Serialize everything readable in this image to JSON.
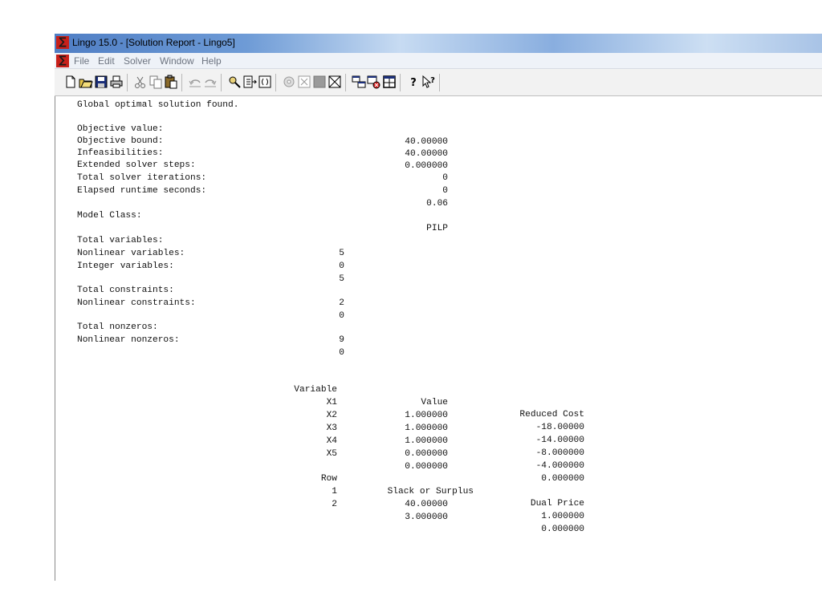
{
  "window": {
    "title": "Lingo 15.0 - [Solution Report - Lingo5]"
  },
  "menu": [
    "File",
    "Edit",
    "Solver",
    "Window",
    "Help"
  ],
  "toolbar": {
    "buttons": [
      "new-icon",
      "open-icon",
      "save-icon",
      "print-icon",
      "cut-icon",
      "copy-icon",
      "paste-icon",
      "undo-icon",
      "redo-icon",
      "find-icon",
      "goto-line-icon",
      "match-paren-icon",
      "solve-icon",
      "solution-icon",
      "stop-icon",
      "close-all-icon",
      "tile-icon",
      "send-to-back-icon",
      "close-window-icon",
      "help-icon",
      "context-help-icon"
    ]
  },
  "report": {
    "status": "Global optimal solution found.",
    "summary": [
      {
        "label": "Objective value:",
        "value": "40.00000"
      },
      {
        "label": "Objective bound:",
        "value": "40.00000"
      },
      {
        "label": "Infeasibilities:",
        "value": "0.000000"
      },
      {
        "label": "Extended solver steps:",
        "value": "0"
      },
      {
        "label": "Total solver iterations:",
        "value": "0"
      },
      {
        "label": "Elapsed runtime seconds:",
        "value": "0.06"
      }
    ],
    "model_class": {
      "label": "Model Class:",
      "value": "PILP"
    },
    "variables": [
      {
        "label": "Total variables:",
        "value": "5"
      },
      {
        "label": "Nonlinear variables:",
        "value": "0"
      },
      {
        "label": "Integer variables:",
        "value": "5"
      }
    ],
    "constraints": [
      {
        "label": "Total constraints:",
        "value": "2"
      },
      {
        "label": "Nonlinear constraints:",
        "value": "0"
      }
    ],
    "nonzeros": [
      {
        "label": "Total nonzeros:",
        "value": "9"
      },
      {
        "label": "Nonlinear nonzeros:",
        "value": "0"
      }
    ],
    "var_table": {
      "headers": [
        "Variable",
        "Value",
        "Reduced Cost"
      ],
      "rows": [
        [
          "X1",
          "1.000000",
          "-18.00000"
        ],
        [
          "X2",
          "1.000000",
          "-14.00000"
        ],
        [
          "X3",
          "1.000000",
          "-8.000000"
        ],
        [
          "X4",
          "0.000000",
          "-4.000000"
        ],
        [
          "X5",
          "0.000000",
          "0.000000"
        ]
      ]
    },
    "row_table": {
      "headers": [
        "Row",
        "Slack or Surplus",
        "Dual Price"
      ],
      "rows": [
        [
          "1",
          "40.00000",
          "1.000000"
        ],
        [
          "2",
          "3.000000",
          "0.000000"
        ]
      ]
    }
  }
}
